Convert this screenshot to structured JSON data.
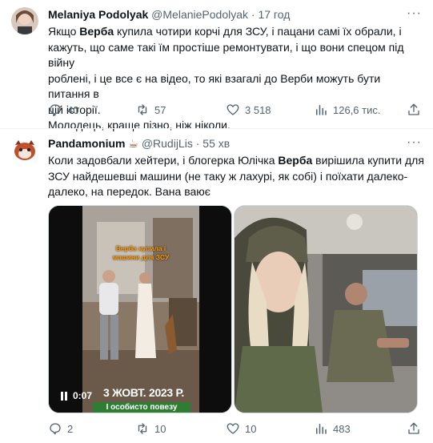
{
  "tweet1": {
    "author_name": "Melaniya Podolyak",
    "handle": "@MelaniePodolyak",
    "time": "17 год",
    "lines": [
      [
        "Якщо ",
        "Верба",
        " купила чотири корчі для ЗСУ, і пацани самі їх обрали, і"
      ],
      [
        "кажуть, що саме такі їм простіше ремонтувати, і що вони спецом під війну"
      ],
      [
        "роблені, і це все є на відео, то які взагалі до Верби можуть бути питання в"
      ],
      [
        "цій історії."
      ]
    ],
    "line5": "Молодець, краще пізно, ніж ніколи.",
    "replies": "40",
    "reposts": "57",
    "likes": "3 518",
    "views": "126,6 тис."
  },
  "tweet2": {
    "author_name": "Pandamonium",
    "author_emoji": "☕",
    "handle": "@RudijLis",
    "time": "55 хв",
    "line1_a": "Коли задовбали хейтери, і блогерка Юлічка ",
    "line1_b": "Верба",
    "line1_c": " вирішила купити для",
    "line2": "ЗСУ найдешевші машини (не таку ж лахурі, як собі) і поїхати далеко-",
    "line3": "далеко, на передок. Вана ваює",
    "video_caption_top": "Верба купила і машини для ЗСУ",
    "video_time": "0:07",
    "video_date": "3 ЖОВТ. 2023 Р.",
    "video_caption_bottom": "І особисто повезу прямо",
    "replies": "2",
    "reposts": "10",
    "likes": "10",
    "views": "483"
  },
  "colors": {
    "text": "#0f1419",
    "muted": "#536471",
    "divider": "#eff3f4"
  }
}
